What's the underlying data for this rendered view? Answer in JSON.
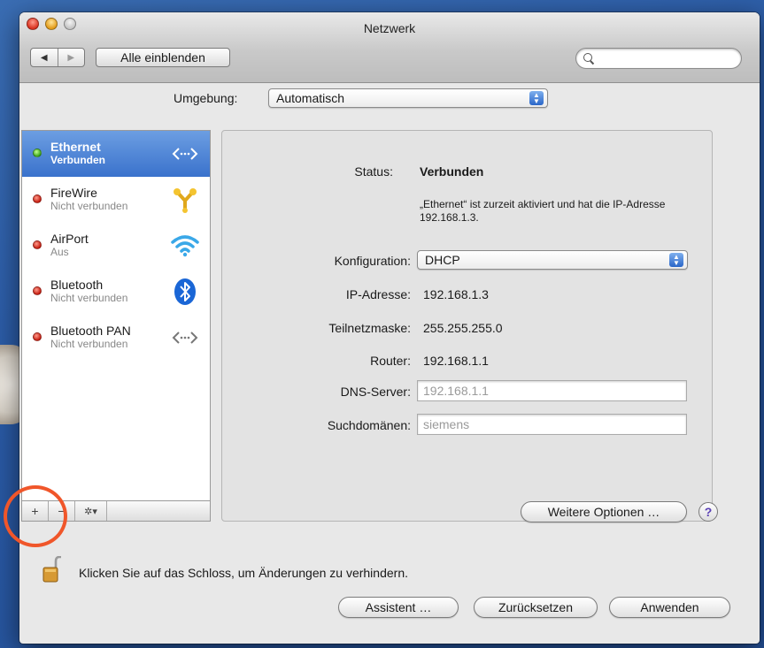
{
  "window": {
    "title": "Netzwerk",
    "show_all_label": "Alle einblenden",
    "search_placeholder": ""
  },
  "location": {
    "label": "Umgebung:",
    "value": "Automatisch"
  },
  "services": [
    {
      "name": "Ethernet",
      "state": "Verbunden",
      "status_color": "green",
      "icon": "ethernet-icon",
      "selected": true
    },
    {
      "name": "FireWire",
      "state": "Nicht verbunden",
      "status_color": "red",
      "icon": "firewire-icon",
      "selected": false
    },
    {
      "name": "AirPort",
      "state": "Aus",
      "status_color": "red",
      "icon": "wifi-icon",
      "selected": false
    },
    {
      "name": "Bluetooth",
      "state": "Nicht verbunden",
      "status_color": "red",
      "icon": "bluetooth-icon",
      "selected": false
    },
    {
      "name": "Bluetooth PAN",
      "state": "Nicht verbunden",
      "status_color": "red",
      "icon": "bluetooth-pan-icon",
      "selected": false
    }
  ],
  "sidebar_toolbar": {
    "add": "+",
    "remove": "−",
    "action": "✲▾"
  },
  "details": {
    "status_label": "Status:",
    "status_value": "Verbunden",
    "status_description": "„Ethernet“ ist zurzeit aktiviert und hat die IP-Adresse 192.168.1.3.",
    "config_label": "Konfiguration:",
    "config_value": "DHCP",
    "ip_label": "IP-Adresse:",
    "ip_value": "192.168.1.3",
    "subnet_label": "Teilnetzmaske:",
    "subnet_value": "255.255.255.0",
    "router_label": "Router:",
    "router_value": "192.168.1.1",
    "dns_label": "DNS-Server:",
    "dns_placeholder": "192.168.1.1",
    "search_domains_label": "Suchdomänen:",
    "search_domains_placeholder": "siemens",
    "more_options": "Weitere Optionen …",
    "help": "?"
  },
  "footer": {
    "lock_text": "Klicken Sie auf das Schloss, um Änderungen zu verhindern.",
    "assistant": "Assistent …",
    "revert": "Zurücksetzen",
    "apply": "Anwenden"
  },
  "colors": {
    "selection": "#3a72cc",
    "status_green": "#3aa51a",
    "status_red": "#c61e12",
    "highlight_ring": "#f0562a"
  }
}
